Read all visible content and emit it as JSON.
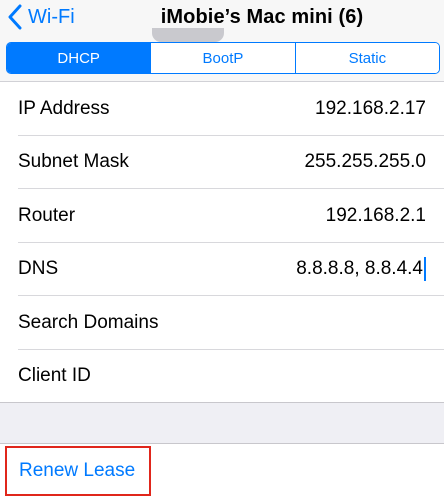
{
  "navbar": {
    "back_label": "Wi-Fi",
    "back_icon": "chevron-left-icon",
    "title": "iMobie’s Mac mini (6)"
  },
  "segments": {
    "items": [
      {
        "label": "DHCP",
        "selected": true
      },
      {
        "label": "BootP",
        "selected": false
      },
      {
        "label": "Static",
        "selected": false
      }
    ]
  },
  "rows": [
    {
      "label": "IP Address",
      "value": "192.168.2.17"
    },
    {
      "label": "Subnet Mask",
      "value": "255.255.255.0"
    },
    {
      "label": "Router",
      "value": "192.168.2.1"
    },
    {
      "label": "DNS",
      "value": "8.8.8.8, 8.8.4.4"
    },
    {
      "label": "Search Domains",
      "value": ""
    },
    {
      "label": "Client ID",
      "value": ""
    }
  ],
  "renew": {
    "label": "Renew Lease",
    "highlight_color": "#e0261b"
  },
  "colors": {
    "accent": "#007aff",
    "highlight": "#e0261b"
  }
}
